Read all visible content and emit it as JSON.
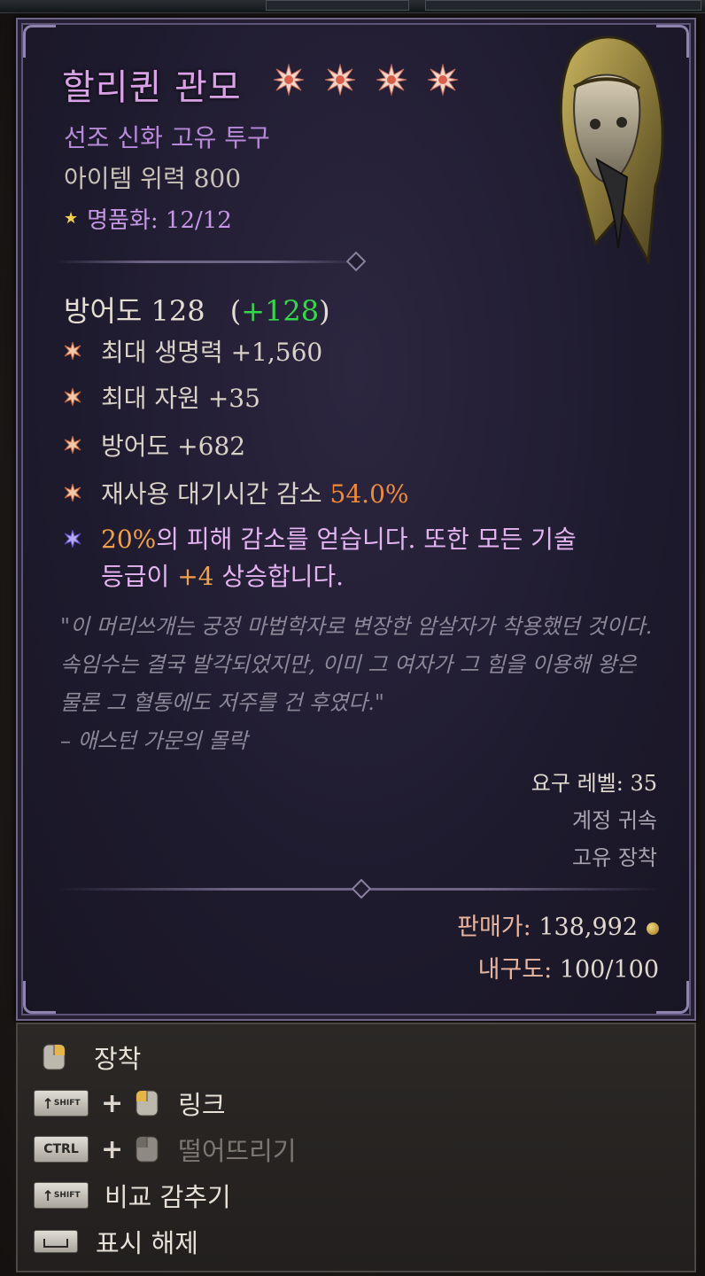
{
  "item": {
    "name": "할리퀸 관모",
    "rank_stars": 4,
    "type": "선조 신화 고유 투구",
    "power": "아이템 위력 800",
    "masterwork_label": "명품화: 12/12",
    "armor_label": "방어도 128",
    "armor_bonus": "+128",
    "armor_paren_open": "(",
    "armor_paren_close": ")"
  },
  "affixes": [
    {
      "text": "최대 생명력 +1,560"
    },
    {
      "text": "최대 자원 +35"
    },
    {
      "text": "방어도 +682"
    },
    {
      "text": "재사용 대기시간 감소 ",
      "highlight": "54.0%"
    }
  ],
  "legendary": {
    "line1_highlight": "20%",
    "line1_rest": "의 피해 감소를 얻습니다. 또한 모든 기술",
    "line2_pre": "등급이 ",
    "line2_highlight": "+4",
    "line2_rest": " 상승합니다."
  },
  "flavor": {
    "text": "\"이 머리쓰개는 궁정 마법학자로 변장한 암살자가 착용했던 것이다. 속임수는 결국 발각되었지만, 이미 그 여자가 그 힘을 이용해 왕은 물론 그 혈통에도 저주를 건 후였다.\"",
    "source": "– 애스턴 가문의 몰락"
  },
  "requirements": {
    "level": "요구 레벨: 35",
    "account_bound": "계정 귀속",
    "unique_equipped": "고유 장착"
  },
  "economy": {
    "sell_label": "판매가:",
    "sell_value": "138,992",
    "durability_label": "내구도:",
    "durability_value": "100/100"
  },
  "controls": [
    {
      "label": "장착",
      "keys": [
        "mouse-right"
      ],
      "enabled": true
    },
    {
      "label": "링크",
      "keys": [
        "SHIFT",
        "mouse-left"
      ],
      "enabled": true
    },
    {
      "label": "떨어뜨리기",
      "keys": [
        "CTRL",
        "mouse-left"
      ],
      "enabled": false
    },
    {
      "label": "비교 감추기",
      "keys": [
        "SHIFT"
      ],
      "enabled": true
    },
    {
      "label": "표시 해제",
      "keys": [
        "SPACE"
      ],
      "enabled": true
    }
  ],
  "key_labels": {
    "shift": "SHIFT",
    "ctrl": "CTRL"
  },
  "colors": {
    "title": "#d9a2e6",
    "subtitle": "#b78ad9",
    "armor_bonus": "#35d84a",
    "highlight_orange": "#f08a3a",
    "legendary_text": "#e4b4f1",
    "flavor": "#8d8897",
    "panel_border": "#6e6488"
  },
  "icons": {
    "rank_star": "ancestral-star-icon",
    "masterwork_star": "gold-star-icon",
    "affix_bullet": "affix-star-icon",
    "legendary_bullet": "legendary-star-icon",
    "currency": "gold-coin-icon"
  }
}
